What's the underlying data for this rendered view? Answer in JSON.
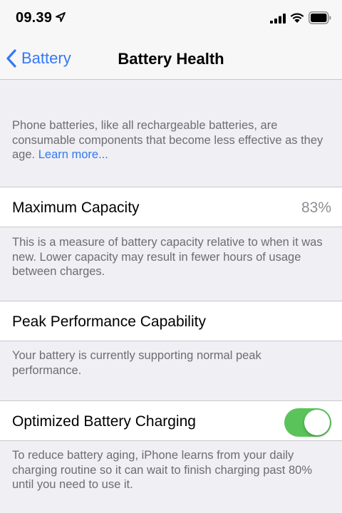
{
  "status_bar": {
    "time": "09.39",
    "icons": [
      "location-arrow-icon",
      "cellular-signal-icon",
      "wifi-icon",
      "battery-icon"
    ]
  },
  "nav": {
    "back_label": "Battery",
    "title": "Battery Health"
  },
  "intro": {
    "text": "Phone batteries, like all rechargeable batteries, are consumable components that become less effective as they age.",
    "link": "Learn more..."
  },
  "maximum_capacity": {
    "label": "Maximum Capacity",
    "value": "83%",
    "footer": "This is a measure of battery capacity relative to when it was new. Lower capacity may result in fewer hours of usage between charges."
  },
  "peak_performance": {
    "label": "Peak Performance Capability",
    "footer": "Your battery is currently supporting normal peak performance."
  },
  "optimized_charging": {
    "label": "Optimized Battery Charging",
    "enabled": true,
    "footer": "To reduce battery aging, iPhone learns from your daily charging routine so it can wait to finish charging past 80% until you need to use it."
  },
  "colors": {
    "accent": "#3478f6",
    "toggle_on": "#5ac35a",
    "background": "#efeff4",
    "secondary_text": "#6d6d72"
  }
}
